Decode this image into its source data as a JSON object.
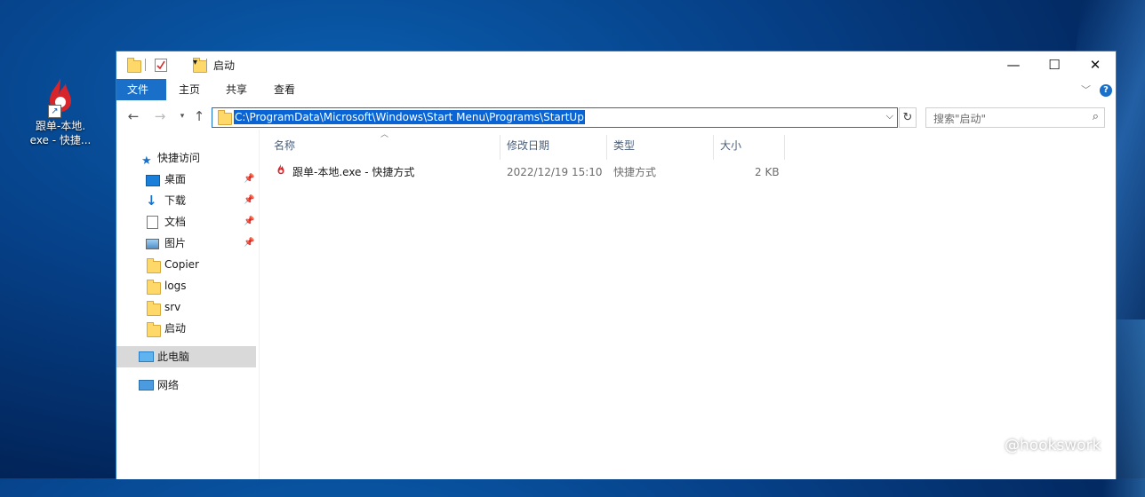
{
  "desktop": {
    "icon_label_line1": "跟单-本地.",
    "icon_label_line2": "exe - 快捷..."
  },
  "window": {
    "title": "启动",
    "controls": {
      "minimize": "—",
      "maximize": "☐",
      "close": "✕"
    }
  },
  "ribbon": {
    "tabs": [
      "文件",
      "主页",
      "共享",
      "查看"
    ]
  },
  "address_bar": {
    "path": "C:\\ProgramData\\Microsoft\\Windows\\Start Menu\\Programs\\StartUp",
    "search_placeholder": "搜索\"启动\""
  },
  "nav_pane": {
    "quick_access": "快捷访问",
    "items": [
      {
        "label": "桌面",
        "icon": "desktop-icon",
        "pinned": true
      },
      {
        "label": "下载",
        "icon": "download-icon",
        "pinned": true
      },
      {
        "label": "文档",
        "icon": "document-icon",
        "pinned": true
      },
      {
        "label": "图片",
        "icon": "picture-icon",
        "pinned": true
      },
      {
        "label": "Copier",
        "icon": "folder-icon",
        "pinned": false
      },
      {
        "label": "logs",
        "icon": "folder-icon",
        "pinned": false
      },
      {
        "label": "srv",
        "icon": "folder-icon",
        "pinned": false
      },
      {
        "label": "启动",
        "icon": "folder-icon",
        "pinned": false
      }
    ],
    "this_pc": "此电脑",
    "network": "网络"
  },
  "file_list": {
    "columns": {
      "name": "名称",
      "modified": "修改日期",
      "type": "类型",
      "size": "大小"
    },
    "rows": [
      {
        "name": "跟单-本地.exe - 快捷方式",
        "modified": "2022/12/19 15:10",
        "type": "快捷方式",
        "size": "2 KB"
      }
    ]
  },
  "watermark": "@hookswork",
  "colors": {
    "accent": "#1a6fc9",
    "selection": "#0a64d4",
    "logo_red": "#d7262b"
  }
}
